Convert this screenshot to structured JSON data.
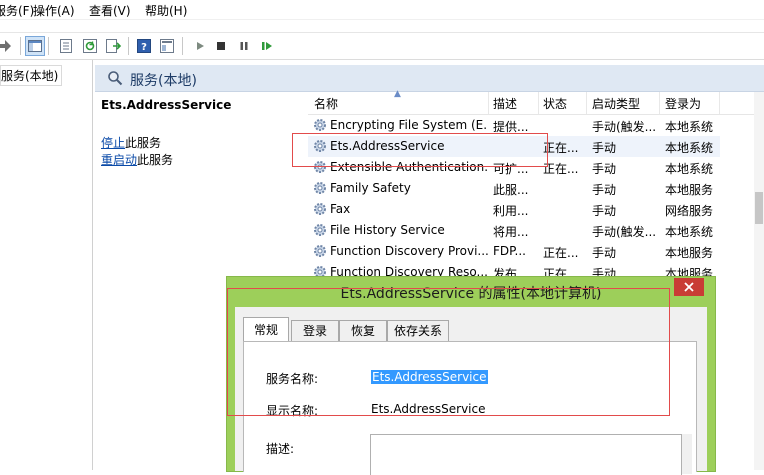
{
  "menu": [
    "服务(F)",
    "操作(A)",
    "查看(V)",
    "帮助(H)"
  ],
  "tree": {
    "item": "服务(本地)"
  },
  "panel": {
    "title": "服务(本地)"
  },
  "description_pane": {
    "selected_name": "Ets.AddressService",
    "stop_link": "停止",
    "stop_suffix": "此服务",
    "restart_link": "重启动",
    "restart_suffix": "此服务"
  },
  "columns": [
    "名称",
    "描述",
    "状态",
    "启动类型",
    "登录为"
  ],
  "services": [
    {
      "name": "Encrypting File System (E...",
      "desc": "提供...",
      "status": "",
      "startup": "手动(触发...",
      "logon": "本地系统"
    },
    {
      "name": "Ets.AddressService",
      "desc": "",
      "status": "正在...",
      "startup": "手动",
      "logon": "本地系统"
    },
    {
      "name": "Extensible Authentication...",
      "desc": "可扩...",
      "status": "正在...",
      "startup": "手动",
      "logon": "本地系统"
    },
    {
      "name": "Family Safety",
      "desc": "此服...",
      "status": "",
      "startup": "手动",
      "logon": "本地服务"
    },
    {
      "name": "Fax",
      "desc": "利用...",
      "status": "",
      "startup": "手动",
      "logon": "网络服务"
    },
    {
      "name": "File History Service",
      "desc": "将用...",
      "status": "",
      "startup": "手动(触发...",
      "logon": "本地系统"
    },
    {
      "name": "Function Discovery Provi...",
      "desc": "FDP...",
      "status": "正在...",
      "startup": "手动",
      "logon": "本地服务"
    },
    {
      "name": "Function Discovery Reso...",
      "desc": "发布...",
      "status": "正在...",
      "startup": "手动",
      "logon": "本地服务"
    }
  ],
  "dialog": {
    "title": "Ets.AddressService 的属性(本地计算机)",
    "tabs": [
      "常规",
      "登录",
      "恢复",
      "依存关系"
    ],
    "service_name_label": "服务名称:",
    "service_name_value": "Ets.AddressService",
    "display_name_label": "显示名称:",
    "display_name_value": "Ets.AddressService",
    "description_label": "描述:"
  },
  "colors": {
    "highlight": "#e24b4b",
    "dialog_frame": "#9dcf5a",
    "selection": "#3399ff"
  }
}
